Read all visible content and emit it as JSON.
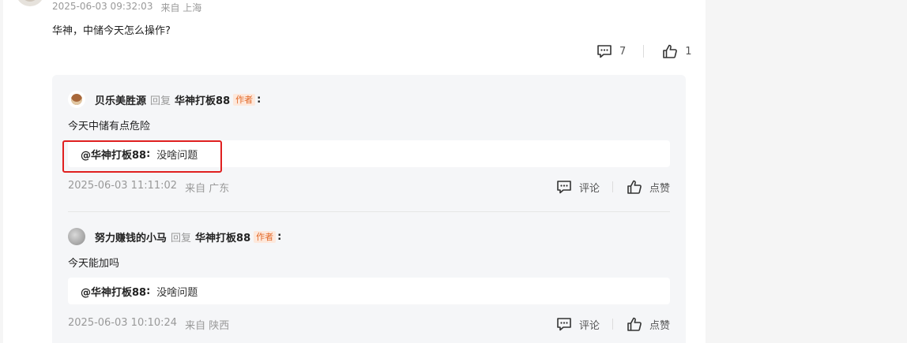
{
  "post": {
    "timestamp": "2025-06-03 09:32:03",
    "location": "来自 上海",
    "text": "华神，中储今天怎么操作?",
    "comment_count": "7",
    "like_count": "1"
  },
  "replies": [
    {
      "user": "贝乐美胜源",
      "reply_word": "回复",
      "target": "华神打板88",
      "tag": "作者",
      "colon": ":",
      "text": "今天中储有点危险",
      "quote_user": "@华神打板88",
      "quote_colon": ":",
      "quote_text": "没啥问题",
      "timestamp": "2025-06-03 11:11:02",
      "location": "来自 广东",
      "comment_label": "评论",
      "like_label": "点赞"
    },
    {
      "user": "努力赚钱的小马",
      "reply_word": "回复",
      "target": "华神打板88",
      "tag": "作者",
      "colon": ":",
      "text": "今天能加吗",
      "quote_user": "@华神打板88",
      "quote_colon": ":",
      "quote_text": "没啥问题",
      "timestamp": "2025-06-03 10:10:24",
      "location": "来自 陕西",
      "comment_label": "评论",
      "like_label": "点赞"
    }
  ],
  "icons": {
    "comment": "comment-icon",
    "like": "thumbs-up-icon"
  },
  "colors": {
    "author_tag": "#e26a2a",
    "highlight_box": "#e02020"
  }
}
